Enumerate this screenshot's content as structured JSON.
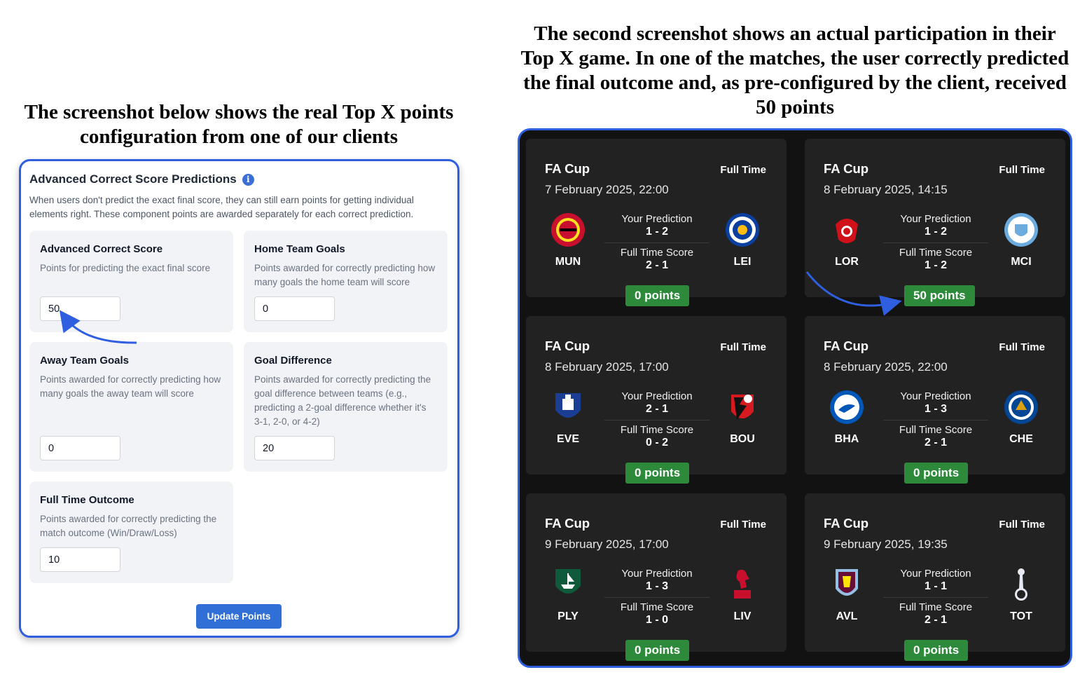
{
  "captions": {
    "left": "The screenshot below shows the real Top X points configuration from one of our clients",
    "right": "The second screenshot shows an actual participation in their Top X game. In one of the matches, the user correctly predicted the final outcome and, as pre-configured by the client, received 50 points"
  },
  "config": {
    "title": "Advanced Correct Score Predictions",
    "info_icon": "info-icon",
    "description": "When users don't predict the exact final score, they can still earn points for getting individual elements right. These component points are awarded separately for each correct prediction.",
    "fields": {
      "advanced_correct_score": {
        "title": "Advanced Correct Score",
        "description": "Points for predicting the exact final score",
        "value": "50"
      },
      "home_team_goals": {
        "title": "Home Team Goals",
        "description": "Points awarded for correctly predicting how many goals the home team will score",
        "value": "0"
      },
      "away_team_goals": {
        "title": "Away Team Goals",
        "description": "Points awarded for correctly predicting how many goals the away team will score",
        "value": "0"
      },
      "goal_difference": {
        "title": "Goal Difference",
        "description": "Points awarded for correctly predicting the goal difference between teams (e.g., predicting a 2-goal difference whether it's 3-1, 2-0, or 4-2)",
        "value": "20"
      },
      "full_time_outcome": {
        "title": "Full Time Outcome",
        "description": "Points awarded for correctly predicting the match outcome (Win/Draw/Loss)",
        "value": "10"
      }
    },
    "update_button": "Update Points",
    "accent_color": "#2f6fd6"
  },
  "matches": [
    {
      "competition": "FA Cup",
      "status": "Full Time",
      "date": "7 February 2025, 22:00",
      "home": "MUN",
      "away": "LEI",
      "prediction_label": "Your Prediction",
      "prediction": "1 - 2",
      "score_label": "Full Time Score",
      "score": "2 - 1",
      "points": "0 points",
      "home_crest": "man-utd-crest-icon",
      "away_crest": "leicester-crest-icon"
    },
    {
      "competition": "FA Cup",
      "status": "Full Time",
      "date": "8 February 2025, 14:15",
      "home": "LOR",
      "away": "MCI",
      "prediction_label": "Your Prediction",
      "prediction": "1 - 2",
      "score_label": "Full Time Score",
      "score": "1 - 2",
      "points": "50 points",
      "home_crest": "leyton-orient-crest-icon",
      "away_crest": "man-city-crest-icon"
    },
    {
      "competition": "FA Cup",
      "status": "Full Time",
      "date": "8 February 2025, 17:00",
      "home": "EVE",
      "away": "BOU",
      "prediction_label": "Your Prediction",
      "prediction": "2 - 1",
      "score_label": "Full Time Score",
      "score": "0 - 2",
      "points": "0 points",
      "home_crest": "everton-crest-icon",
      "away_crest": "bournemouth-crest-icon"
    },
    {
      "competition": "FA Cup",
      "status": "Full Time",
      "date": "8 February 2025, 22:00",
      "home": "BHA",
      "away": "CHE",
      "prediction_label": "Your Prediction",
      "prediction": "1 - 3",
      "score_label": "Full Time Score",
      "score": "2 - 1",
      "points": "0 points",
      "home_crest": "brighton-crest-icon",
      "away_crest": "chelsea-crest-icon"
    },
    {
      "competition": "FA Cup",
      "status": "Full Time",
      "date": "9 February 2025, 17:00",
      "home": "PLY",
      "away": "LIV",
      "prediction_label": "Your Prediction",
      "prediction": "1 - 3",
      "score_label": "Full Time Score",
      "score": "1 - 0",
      "points": "0 points",
      "home_crest": "plymouth-crest-icon",
      "away_crest": "liverpool-crest-icon"
    },
    {
      "competition": "FA Cup",
      "status": "Full Time",
      "date": "9 February 2025, 19:35",
      "home": "AVL",
      "away": "TOT",
      "prediction_label": "Your Prediction",
      "prediction": "1 - 1",
      "score_label": "Full Time Score",
      "score": "2 - 1",
      "points": "0 points",
      "home_crest": "aston-villa-crest-icon",
      "away_crest": "tottenham-crest-icon"
    }
  ],
  "colors": {
    "points_badge": "#2d8a3b",
    "panel_border": "#2f5fe0",
    "card_bg": "#222222"
  }
}
